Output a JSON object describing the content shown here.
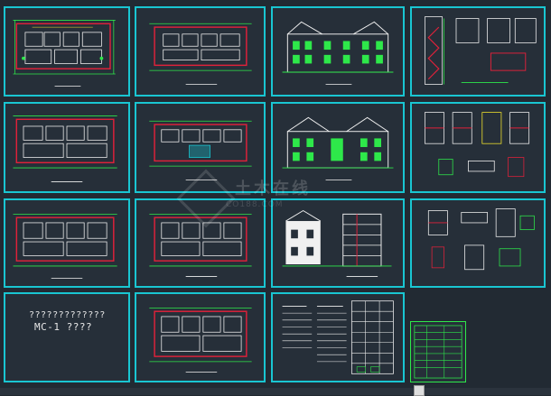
{
  "sheets": [
    {
      "id": "plan-1",
      "type": "plan"
    },
    {
      "id": "plan-2",
      "type": "plan-red"
    },
    {
      "id": "elevation-1",
      "type": "elevation"
    },
    {
      "id": "detail-stair",
      "type": "detail"
    },
    {
      "id": "plan-3",
      "type": "plan"
    },
    {
      "id": "plan-4",
      "type": "plan-red"
    },
    {
      "id": "elevation-2",
      "type": "elevation"
    },
    {
      "id": "detail-2",
      "type": "detail"
    },
    {
      "id": "plan-5",
      "type": "plan"
    },
    {
      "id": "plan-6",
      "type": "plan"
    },
    {
      "id": "section-1",
      "type": "section"
    },
    {
      "id": "detail-3",
      "type": "detail"
    },
    {
      "id": "notes",
      "type": "text"
    },
    {
      "id": "plan-7",
      "type": "plan"
    },
    {
      "id": "schedule",
      "type": "table"
    }
  ],
  "notes_sheet": {
    "line1": "?????????????",
    "line2": "MC-1 ????"
  },
  "watermark": {
    "title": "土木在线",
    "sub": "CO188.COM"
  },
  "colors": {
    "background": "#222a33",
    "frame": "#19c6d2",
    "wall_red": "#e0213a",
    "line_green": "#2ee84a",
    "line_white": "#f0f0f0",
    "line_yellow": "#f3e52c"
  }
}
